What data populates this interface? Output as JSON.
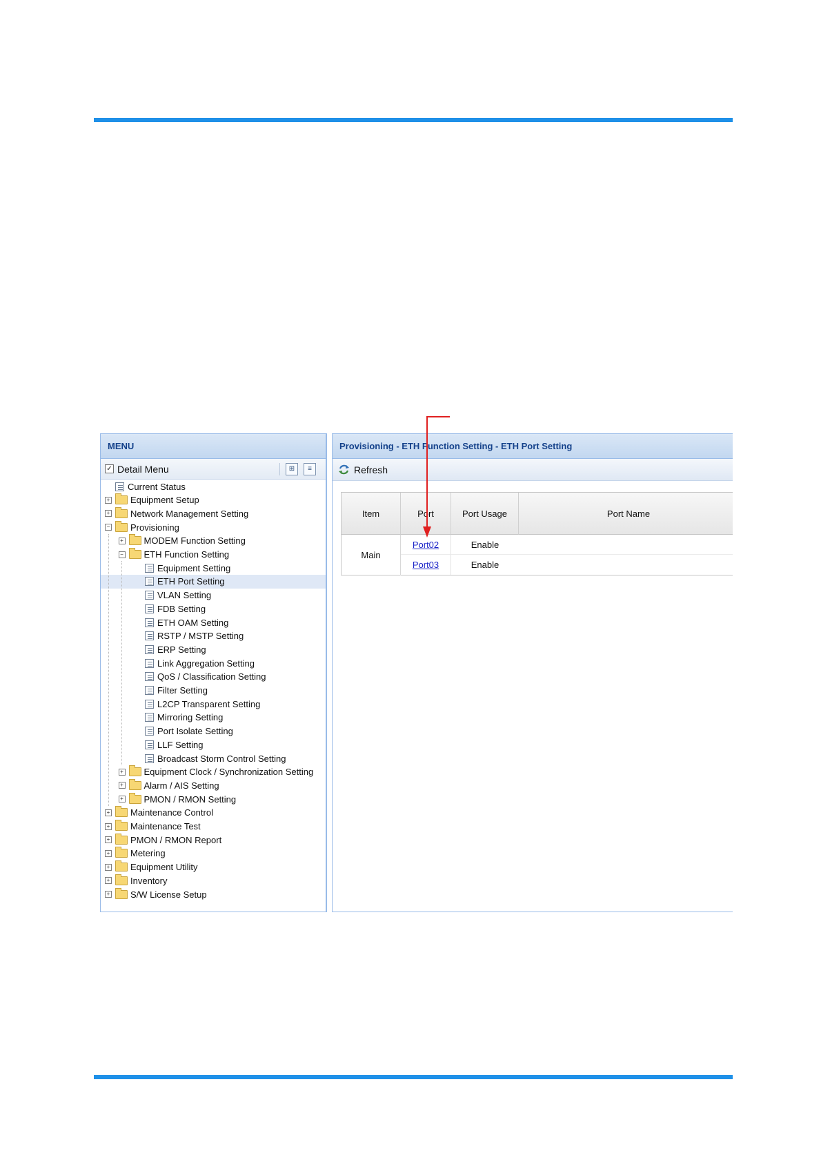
{
  "menu": {
    "title": "MENU",
    "detail_menu": {
      "label": "Detail Menu",
      "checked": true
    },
    "tree": [
      {
        "label": "Current Status",
        "kind": "leaf",
        "level": 0
      },
      {
        "label": "Equipment Setup",
        "kind": "folder",
        "level": 0,
        "expanded": false
      },
      {
        "label": "Network Management Setting",
        "kind": "folder",
        "level": 0,
        "expanded": false
      },
      {
        "label": "Provisioning",
        "kind": "folder",
        "level": 0,
        "expanded": true
      },
      {
        "label": "MODEM Function Setting",
        "kind": "folder",
        "level": 1,
        "expanded": false
      },
      {
        "label": "ETH Function Setting",
        "kind": "folder",
        "level": 1,
        "expanded": true
      },
      {
        "label": "Equipment Setting",
        "kind": "leaf",
        "level": 2
      },
      {
        "label": "ETH Port Setting",
        "kind": "leaf",
        "level": 2,
        "selected": true
      },
      {
        "label": "VLAN Setting",
        "kind": "leaf",
        "level": 2
      },
      {
        "label": "FDB Setting",
        "kind": "leaf",
        "level": 2
      },
      {
        "label": "ETH OAM Setting",
        "kind": "leaf",
        "level": 2
      },
      {
        "label": "RSTP / MSTP Setting",
        "kind": "leaf",
        "level": 2
      },
      {
        "label": "ERP Setting",
        "kind": "leaf",
        "level": 2
      },
      {
        "label": "Link Aggregation Setting",
        "kind": "leaf",
        "level": 2
      },
      {
        "label": "QoS / Classification Setting",
        "kind": "leaf",
        "level": 2
      },
      {
        "label": "Filter Setting",
        "kind": "leaf",
        "level": 2
      },
      {
        "label": "L2CP Transparent Setting",
        "kind": "leaf",
        "level": 2
      },
      {
        "label": "Mirroring Setting",
        "kind": "leaf",
        "level": 2
      },
      {
        "label": "Port Isolate Setting",
        "kind": "leaf",
        "level": 2
      },
      {
        "label": "LLF Setting",
        "kind": "leaf",
        "level": 2
      },
      {
        "label": "Broadcast Storm Control Setting",
        "kind": "leaf",
        "level": 2
      },
      {
        "label": "Equipment Clock / Synchronization Setting",
        "kind": "folder",
        "level": 1,
        "expanded": false
      },
      {
        "label": "Alarm / AIS Setting",
        "kind": "folder",
        "level": 1,
        "expanded": false
      },
      {
        "label": "PMON / RMON Setting",
        "kind": "folder",
        "level": 1,
        "expanded": false
      },
      {
        "label": "Maintenance Control",
        "kind": "folder",
        "level": 0,
        "expanded": false
      },
      {
        "label": "Maintenance Test",
        "kind": "folder",
        "level": 0,
        "expanded": false
      },
      {
        "label": "PMON / RMON Report",
        "kind": "folder",
        "level": 0,
        "expanded": false
      },
      {
        "label": "Metering",
        "kind": "folder",
        "level": 0,
        "expanded": false
      },
      {
        "label": "Equipment Utility",
        "kind": "folder",
        "level": 0,
        "expanded": false
      },
      {
        "label": "Inventory",
        "kind": "folder",
        "level": 0,
        "expanded": false
      },
      {
        "label": "S/W License Setup",
        "kind": "folder",
        "level": 0,
        "expanded": false
      }
    ]
  },
  "content": {
    "breadcrumb": "Provisioning - ETH Function Setting - ETH Port Setting",
    "refresh_label": "Refresh",
    "table": {
      "headers": [
        "Item",
        "Port",
        "Port Usage",
        "Port Name"
      ],
      "group": "Main",
      "rows": [
        {
          "port": "Port02",
          "usage": "Enable",
          "name": ""
        },
        {
          "port": "Port03",
          "usage": "Enable",
          "name": ""
        }
      ]
    }
  },
  "colors": {
    "rule": "#1e90e8",
    "header_text": "#15428b",
    "link": "#1a23c8",
    "annotation": "#e02020",
    "selection": "#dfe8f6"
  }
}
